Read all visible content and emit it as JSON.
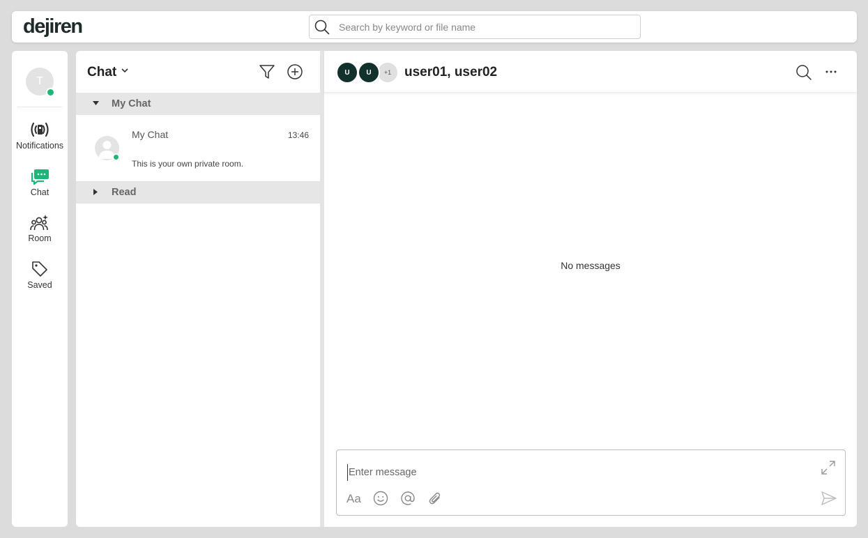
{
  "app": {
    "logo": "dejiren",
    "search": {
      "placeholder": "Search by keyword or file name"
    }
  },
  "rail": {
    "user_initial": "T",
    "items": [
      {
        "label": "Notifications",
        "icon": "broadcast-icon"
      },
      {
        "label": "Chat",
        "icon": "chat-bubble-icon",
        "active": true
      },
      {
        "label": "Room",
        "icon": "group-icon"
      },
      {
        "label": "Saved",
        "icon": "tag-icon"
      }
    ]
  },
  "list": {
    "title": "Chat",
    "sections": [
      {
        "label": "My Chat",
        "expanded": true
      },
      {
        "label": "Read",
        "expanded": false
      }
    ],
    "items": [
      {
        "name": "My Chat",
        "time": "13:46",
        "preview": "This is your own private room."
      }
    ]
  },
  "room": {
    "members": [
      "U",
      "U"
    ],
    "more_members": "+1",
    "title": "user01, user02",
    "empty_text": "No messages",
    "composer_placeholder": "Enter message",
    "format_label": "Aa"
  },
  "colors": {
    "accent": "#1fb578",
    "avatar_dark": "#12302c",
    "background": "#dcdcdc"
  }
}
